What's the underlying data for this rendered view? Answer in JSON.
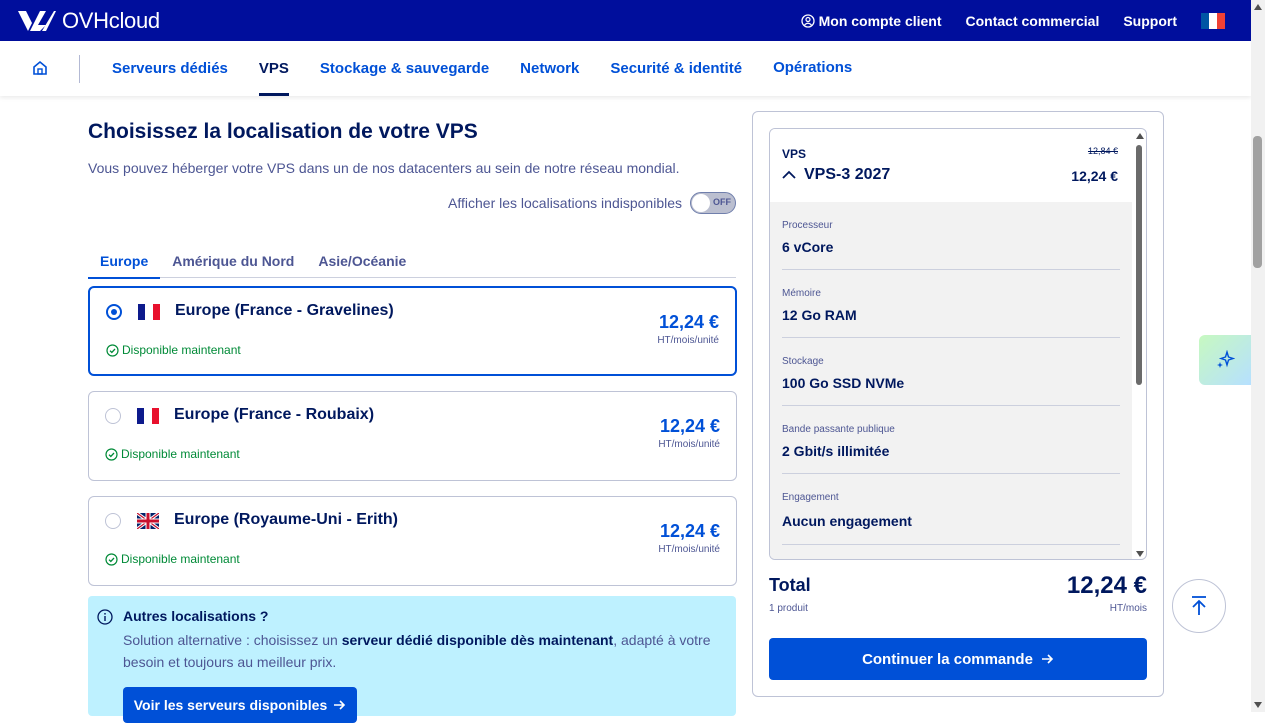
{
  "brand": {
    "name": "OVHcloud",
    "color": "#000e9c",
    "accent": "#0050d7",
    "success": "#008a37"
  },
  "topbar": {
    "account": "Mon compte client",
    "contact": "Contact commercial",
    "support": "Support",
    "account_icon": "user-circle-icon",
    "flag_icon": "flag-france-icon"
  },
  "nav": {
    "home_icon": "home-icon",
    "items": [
      "Serveurs dédiés",
      "VPS",
      "Stockage & sauvegarde",
      "Network",
      "Securité & identité",
      "Opérations"
    ],
    "active": "VPS"
  },
  "main": {
    "title": "Choisissez la localisation de votre VPS",
    "subtitle": "Vous pouvez héberger votre VPS dans un de nos datacenters au sein de notre réseau mondial.",
    "unavailable_label": "Afficher les localisations indisponibles",
    "toggle_label": "OFF",
    "tabs": [
      "Europe",
      "Amérique du Nord",
      "Asie/Océanie"
    ],
    "locations": [
      {
        "name": "Europe (France - Gravelines)",
        "status": "Disponible maintenant",
        "price": "12,24 €",
        "unit": "HT/mois/unité",
        "flag": "flag-france-icon",
        "selected": true
      },
      {
        "name": "Europe (France - Roubaix)",
        "status": "Disponible maintenant",
        "price": "12,24 €",
        "unit": "HT/mois/unité",
        "flag": "flag-france-icon",
        "selected": false
      },
      {
        "name": "Europe (Royaume-Uni - Erith)",
        "status": "Disponible maintenant",
        "price": "12,24 €",
        "unit": "HT/mois/unité",
        "flag": "flag-uk-icon",
        "selected": false
      }
    ],
    "info": {
      "title": "Autres localisations ?",
      "text_before": "Solution alternative : choisissez un ",
      "text_bold": "serveur dédié disponible dès maintenant",
      "text_after": ", adapté à votre besoin et toujours au meilleur prix.",
      "button": "Voir les serveurs disponibles"
    }
  },
  "summary": {
    "category": "VPS",
    "product": "VPS-3 2027",
    "old_price": "12,84 €",
    "price": "12,24 €",
    "specs": [
      {
        "label": "Processeur",
        "value": "6 vCore"
      },
      {
        "label": "Mémoire",
        "value": "12 Go RAM"
      },
      {
        "label": "Stockage",
        "value": "100 Go SSD NVMe"
      },
      {
        "label": "Bande passante publique",
        "value": "2 Gbit/s illimitée"
      },
      {
        "label": "Engagement",
        "value": "Aucun engagement"
      }
    ],
    "total_label": "Total",
    "total_sub": "1 produit",
    "total_value": "12,24 €",
    "total_unit": "HT/mois",
    "continue": "Continuer la commande"
  },
  "floating": {
    "ai_icon": "sparkles-icon",
    "top_icon": "arrow-up-to-top-icon"
  }
}
